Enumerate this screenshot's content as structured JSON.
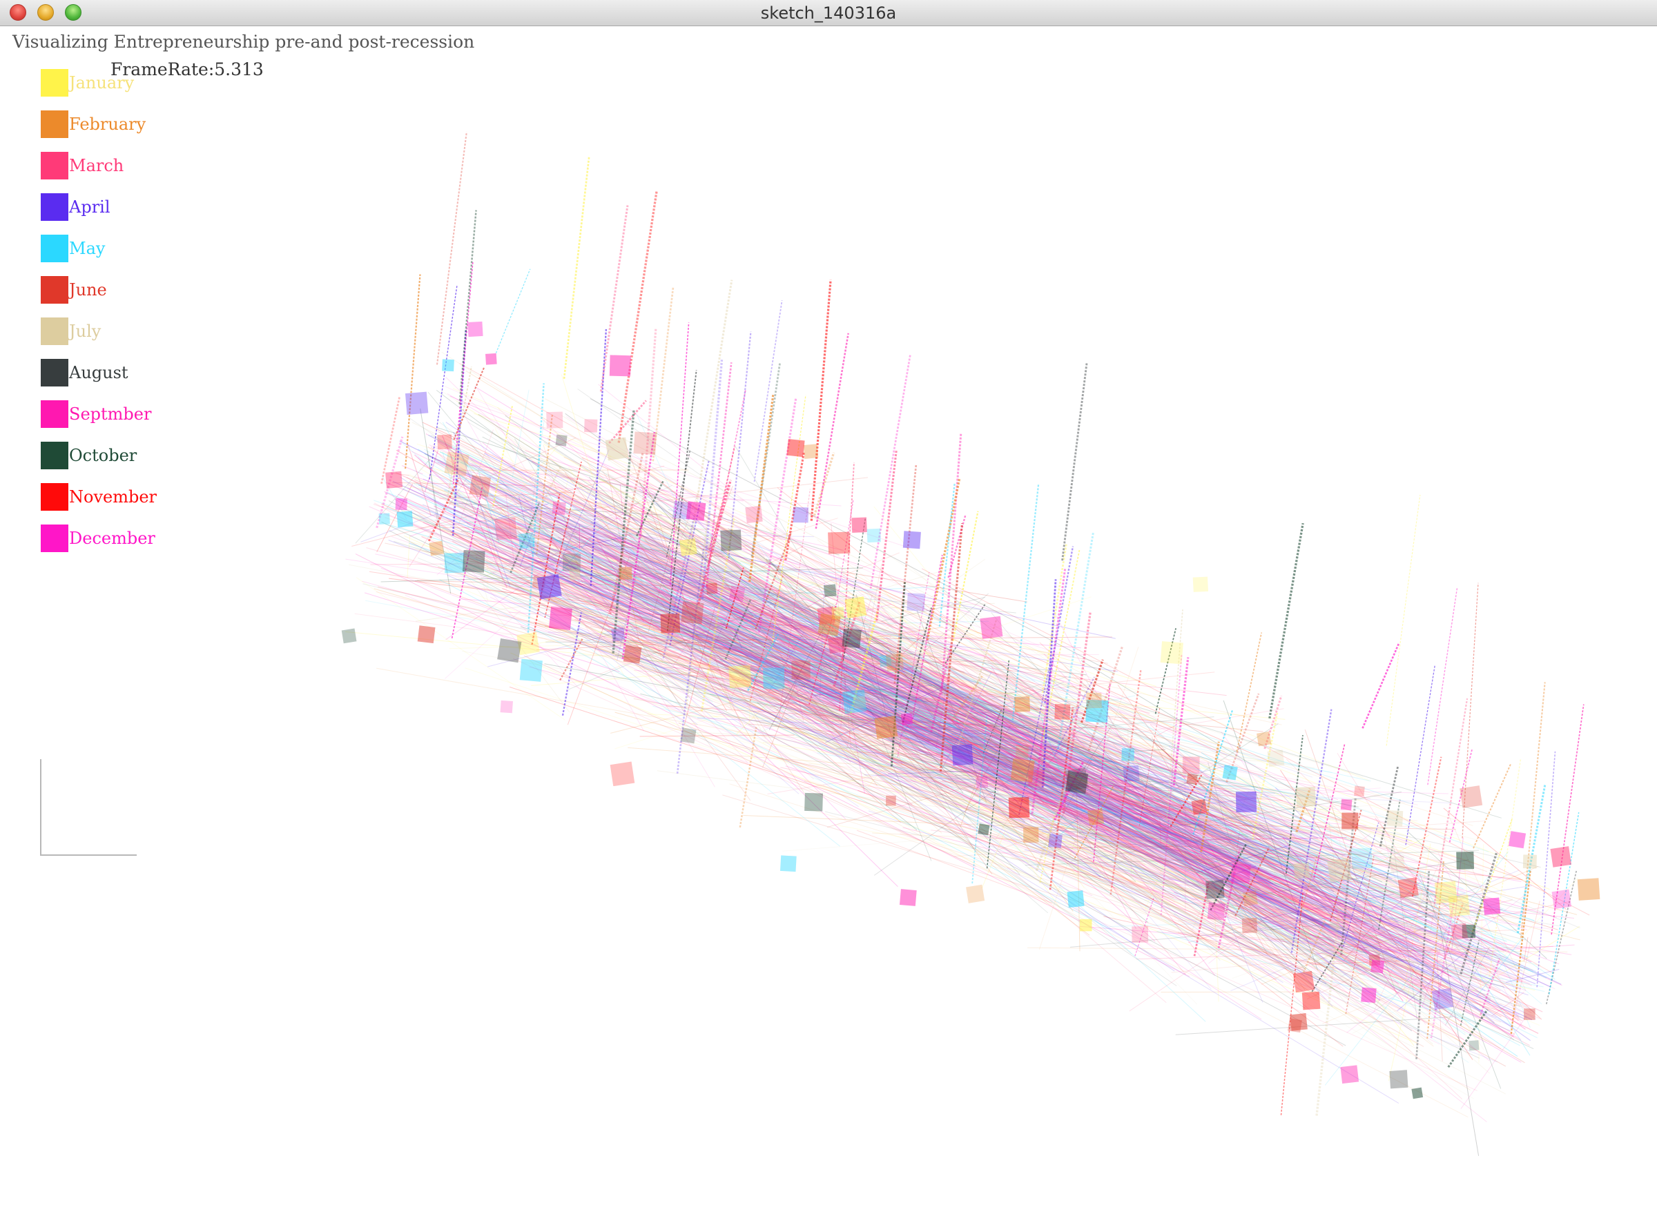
{
  "window": {
    "title": "sketch_140316a"
  },
  "app": {
    "title": "Visualizing Entrepreneurship pre-and post-recession",
    "framerate": "FrameRate:5.313"
  },
  "legend": {
    "items": [
      {
        "label": "January",
        "color": "#fff34a",
        "label_color": "#f6e27a"
      },
      {
        "label": "February",
        "color": "#ec8a2b",
        "label_color": "#ec8a2b"
      },
      {
        "label": "March",
        "color": "#ff3a78",
        "label_color": "#ff3a78"
      },
      {
        "label": "April",
        "color": "#5a2cf0",
        "label_color": "#5a2cf0"
      },
      {
        "label": "May",
        "color": "#2bd8ff",
        "label_color": "#2bd8ff"
      },
      {
        "label": "June",
        "color": "#e0382a",
        "label_color": "#e0382a"
      },
      {
        "label": "July",
        "color": "#ddcd9f",
        "label_color": "#ddcd9f"
      },
      {
        "label": "August",
        "color": "#373d3e",
        "label_color": "#373d3e"
      },
      {
        "label": "Septmber",
        "color": "#ff18b0",
        "label_color": "#ff18b0"
      },
      {
        "label": "October",
        "color": "#1f4a36",
        "label_color": "#1f4a36"
      },
      {
        "label": "November",
        "color": "#ff0a0a",
        "label_color": "#ff0a0a"
      },
      {
        "label": "December",
        "color": "#ff16c8",
        "label_color": "#ff16c8"
      }
    ]
  },
  "visualization": {
    "type": "3d-network",
    "background": "#ffffff"
  }
}
